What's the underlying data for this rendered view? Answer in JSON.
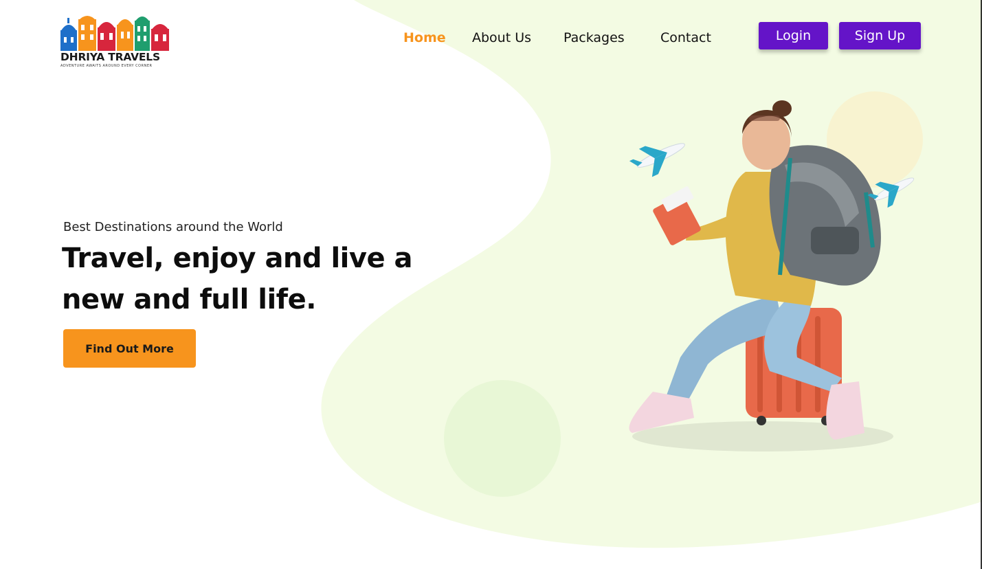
{
  "brand": {
    "name": "DHRIYA TRAVELS",
    "tagline": "ADVENTURE AWAITS AROUND EVERY CORNER"
  },
  "nav": {
    "items": [
      {
        "label": "Home",
        "active": true
      },
      {
        "label": "About Us",
        "active": false
      },
      {
        "label": "Packages",
        "active": false
      },
      {
        "label": "Contact",
        "active": false
      }
    ]
  },
  "auth": {
    "login_label": "Login",
    "signup_label": "Sign Up"
  },
  "hero": {
    "kicker": "Best Destinations around the World",
    "headline": "Travel, enjoy and live a new and full life.",
    "cta_label": "Find Out More"
  },
  "colors": {
    "accent": "#f7941d",
    "primary_button": "#6414c8",
    "blob": "#f3fbe3",
    "circle_light": "#eaf8dc",
    "circle_yellow": "#f8f3d0"
  },
  "icons": [
    "airplane-icon",
    "city-skyline-logo"
  ]
}
